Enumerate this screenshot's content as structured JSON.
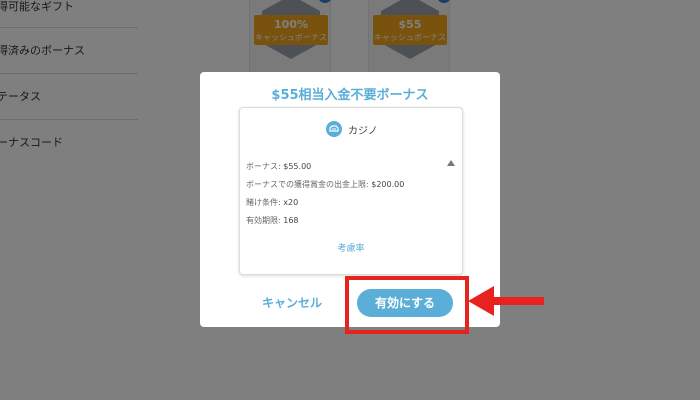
{
  "sidebar": {
    "items": [
      {
        "label": "得可能なギフト"
      },
      {
        "label": "得済みのボーナス"
      },
      {
        "label": "テータス"
      },
      {
        "label": "ーナスコード"
      }
    ]
  },
  "gifts": [
    {
      "amount": "100%",
      "caption": "キャッシュボーナス",
      "info": "i"
    },
    {
      "amount": "$55",
      "caption": "キャッシュボーナス",
      "info": "i"
    }
  ],
  "modal": {
    "title": "$55相当入金不要ボーナス",
    "category": "カジノ",
    "details": [
      {
        "label": "ボーナス:",
        "value": "$55.00"
      },
      {
        "label": "ボーナスでの獲得賞金の出金上限:",
        "value": "$200.00"
      },
      {
        "label": "賭け条件:",
        "value": "x20"
      },
      {
        "label": "有効期限:",
        "value": "168"
      }
    ],
    "terms_link": "考慮率",
    "cancel_label": "キャンセル",
    "activate_label": "有効にする"
  },
  "colors": {
    "accent": "#5aaed8",
    "annotation_red": "#e8231f",
    "ribbon": "#f2a51a"
  }
}
